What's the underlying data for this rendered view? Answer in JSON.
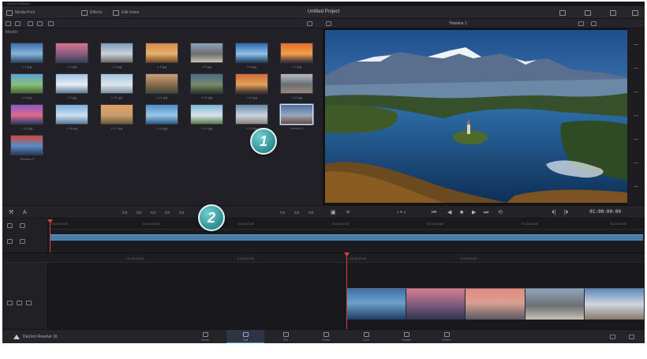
{
  "window": {
    "project_title": "Untitled Project"
  },
  "toolbar": {
    "media_pool_label": "Media Pool",
    "effects_label": "Effects",
    "edit_index_label": "Edit Index",
    "timeline_label": "Timeline 1"
  },
  "media_pool": {
    "label": "Master",
    "clips": [
      {
        "name": "1-1.jpg"
      },
      {
        "name": "1-2.jpg"
      },
      {
        "name": "1-3.jpg"
      },
      {
        "name": "1-4.jpg"
      },
      {
        "name": "1-5.jpg"
      },
      {
        "name": "1-6.jpg"
      },
      {
        "name": "1-7.jpg"
      },
      {
        "name": "1-8.jpg"
      },
      {
        "name": "1-9.jpg"
      },
      {
        "name": "1-10.jpg"
      },
      {
        "name": "1-11.jpg"
      },
      {
        "name": "1-12.jpg"
      },
      {
        "name": "1-13.jpg"
      },
      {
        "name": "1-14.jpg"
      },
      {
        "name": "1-15.jpg"
      },
      {
        "name": "1-16.jpg"
      },
      {
        "name": "1-17.jpg"
      },
      {
        "name": "1-18.jpg"
      },
      {
        "name": "1-19.jpg"
      },
      {
        "name": "1-20.jpg"
      },
      {
        "name": "Timeline 1"
      },
      {
        "name": "Timeline 2"
      }
    ],
    "selected_index": 20
  },
  "callouts": [
    "1",
    "2"
  ],
  "viewer": {
    "timeline_name": "Timeline 1",
    "timecode": "01:00:00:00"
  },
  "transport": {
    "prev_clip": "⏮",
    "rewind": "◀",
    "stop": "■",
    "play": "▶",
    "next_clip": "⏭",
    "loop": "⟲"
  },
  "upper_ruler": [
    "01:00:00:00",
    "01:00:10:00",
    "01:00:20:00",
    "01:00:30:00",
    "01:00:40:00",
    "01:00:50:00",
    "01:01:00:00"
  ],
  "lower_ruler": [
    "01:00:00:00",
    "01:00:02:00",
    "01:00:04:00",
    "01:00:06:00"
  ],
  "brand": "DaVinci Resolve 16",
  "pages": [
    {
      "label": "Media",
      "icon": "media-icon"
    },
    {
      "label": "Cut",
      "icon": "cut-icon"
    },
    {
      "label": "Edit",
      "icon": "edit-icon"
    },
    {
      "label": "Fusion",
      "icon": "fusion-icon"
    },
    {
      "label": "Color",
      "icon": "color-icon"
    },
    {
      "label": "Fairlight",
      "icon": "fairlight-icon"
    },
    {
      "label": "Deliver",
      "icon": "deliver-icon"
    }
  ],
  "active_page": 1,
  "colors": {
    "accent": "#5b8fd3",
    "playhead": "#d9403a",
    "timeline_bar": "#4a7ea8",
    "callout": "#3aa3a6"
  }
}
